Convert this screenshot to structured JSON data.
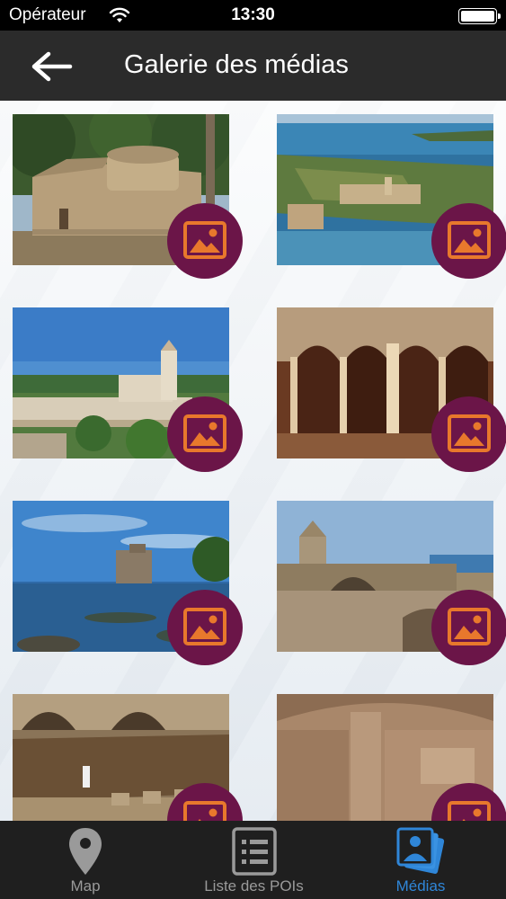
{
  "status": {
    "carrier": "Opérateur",
    "time": "13:30"
  },
  "header": {
    "title": "Galerie des médias",
    "back_icon": "arrow-left-icon"
  },
  "gallery": {
    "badge_icon": "image-icon",
    "colors": {
      "badge": "#6b1548",
      "badge_icon": "#e8782c"
    },
    "items": [
      {
        "photo": "chapel"
      },
      {
        "photo": "island-aerial"
      },
      {
        "photo": "abbey"
      },
      {
        "photo": "cloister"
      },
      {
        "photo": "seaside-tower"
      },
      {
        "photo": "fortress-ruins"
      },
      {
        "photo": "rampart-courtyard"
      },
      {
        "photo": "stone-interior"
      }
    ]
  },
  "tabs": [
    {
      "label": "Map",
      "icon": "map-pin-icon",
      "active": false
    },
    {
      "label": "Liste des POIs",
      "icon": "list-icon",
      "active": false
    },
    {
      "label": "Médias",
      "icon": "media-gallery-icon",
      "active": true
    }
  ],
  "colors": {
    "accent": "#2f86d8",
    "header": "#2b2b2b",
    "tab_bar": "#1f1f1f"
  }
}
